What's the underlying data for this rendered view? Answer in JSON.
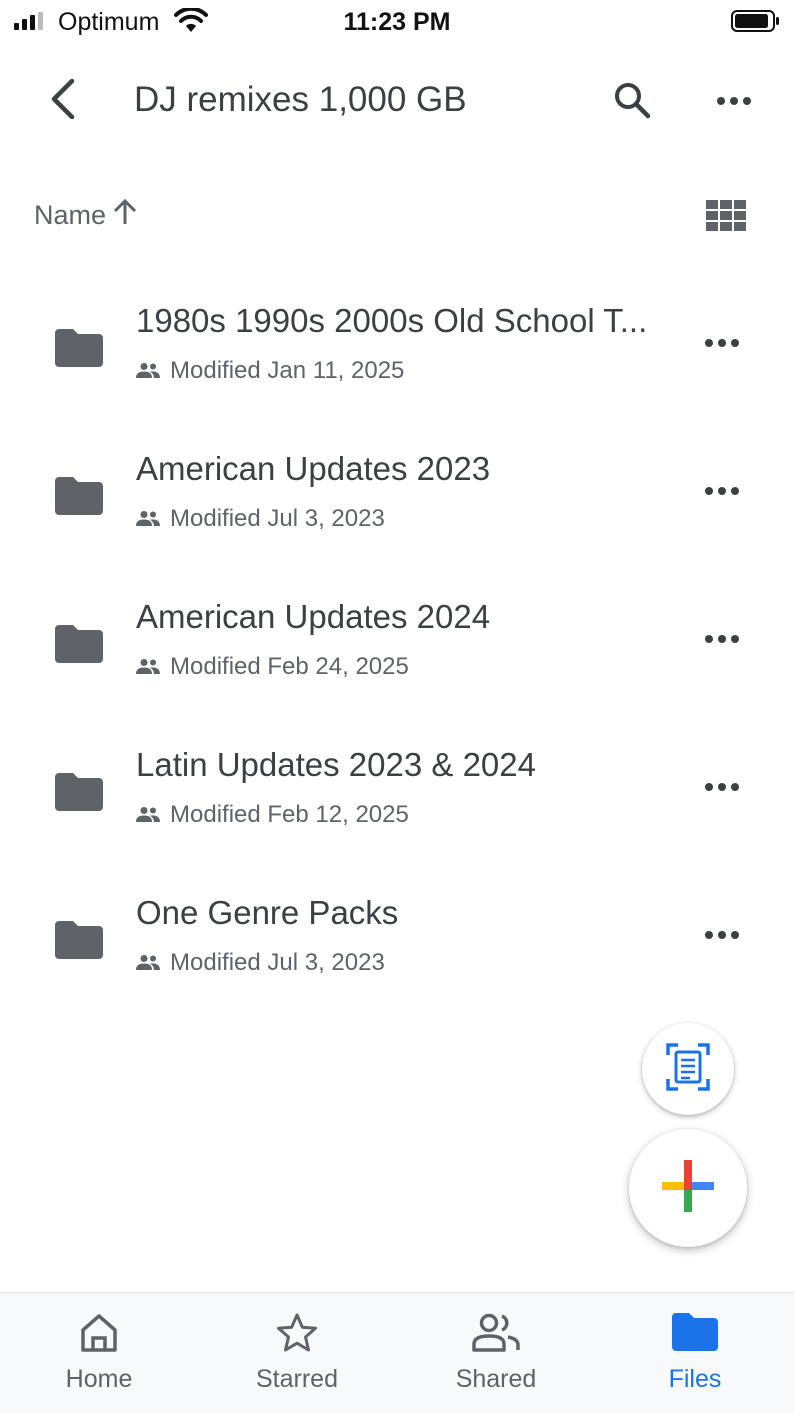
{
  "status_bar": {
    "carrier": "Optimum",
    "time": "11:23 PM"
  },
  "header": {
    "title": "DJ remixes 1,000 GB",
    "back_icon": "chevron-left-icon",
    "search_icon": "search-icon",
    "more_icon": "more-horizontal-icon"
  },
  "sort": {
    "label": "Name",
    "direction_icon": "arrow-up-icon",
    "view_icon": "grid-view-icon"
  },
  "files": [
    {
      "name": "1980s 1990s 2000s Old School T...",
      "meta": "Modified Jan 11, 2025",
      "shared": true
    },
    {
      "name": "American Updates 2023",
      "meta": "Modified Jul 3, 2023",
      "shared": true
    },
    {
      "name": "American Updates 2024",
      "meta": "Modified Feb 24, 2025",
      "shared": true
    },
    {
      "name": "Latin Updates 2023 & 2024",
      "meta": "Modified Feb 12, 2025",
      "shared": true
    },
    {
      "name": "One Genre Packs",
      "meta": "Modified Jul 3, 2023",
      "shared": true
    }
  ],
  "fabs": {
    "scan_icon": "document-scan-icon",
    "new_icon": "plus-icon"
  },
  "bottom_nav": {
    "items": [
      {
        "label": "Home",
        "icon": "home-icon",
        "active": false
      },
      {
        "label": "Starred",
        "icon": "star-icon",
        "active": false
      },
      {
        "label": "Shared",
        "icon": "people-icon",
        "active": false
      },
      {
        "label": "Files",
        "icon": "folder-icon",
        "active": true
      }
    ]
  },
  "colors": {
    "accent": "#1a73e8",
    "text_primary": "#3c4043",
    "text_secondary": "#5f6368",
    "icon": "#5f6368",
    "plus_red": "#ea4335",
    "plus_yellow": "#fbbc04",
    "plus_green": "#34a853",
    "plus_blue": "#4285f4"
  }
}
